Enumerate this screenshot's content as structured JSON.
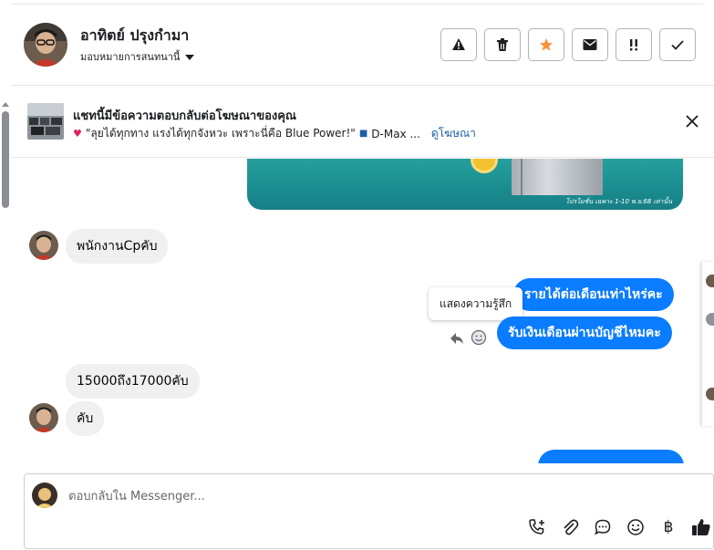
{
  "header": {
    "contact_name": "อาทิตย์ ปรุงกำมา",
    "assign_label": "มอบหมายการสนทนานี้",
    "actions": [
      {
        "name": "report-button",
        "icon": "warning-icon"
      },
      {
        "name": "delete-button",
        "icon": "trash-icon"
      },
      {
        "name": "star-button",
        "icon": "star-icon",
        "color": "#f7923b"
      },
      {
        "name": "mark-unread-button",
        "icon": "envelope-icon"
      },
      {
        "name": "priority-button",
        "icon": "double-exclamation-icon"
      },
      {
        "name": "done-button",
        "icon": "checkmark-icon"
      }
    ]
  },
  "notice": {
    "title": "แชทนี้มีข้อความตอบกลับต่อโฆษณาของคุณ",
    "ad_text": "\"ลุยได้ทุกทาง แรงได้ทุกจังหวะ เพราะนี่คือ Blue Power!\"",
    "ad_brand": "D-Max ...",
    "link_label": "ดูโฆษณา"
  },
  "chat": {
    "ad_image_caption": "โปรโมชั่น เฉพาะ 1-10 พ.ย.68 เท่านั้น",
    "incoming_1": "พนักงานCpคับ",
    "outgoing_1": "รายได้ต่อเดือนเท่าไหร่คะ",
    "outgoing_2": "รับเงินเดือนผ่านบัญชีไหมคะ",
    "tooltip": "แสดงความรู้สึก",
    "incoming_2": "15000ถึง17000คับ",
    "incoming_3": "คับ"
  },
  "composer": {
    "placeholder": "ตอบกลับใน Messenger...",
    "tools": [
      "phone-add-icon",
      "paperclip-icon",
      "saved-reply-icon",
      "emoji-icon",
      "baht-icon",
      "thumbs-up-icon"
    ],
    "baht_symbol": "฿"
  },
  "colors": {
    "accent_blue": "#0a7cff",
    "incoming_bubble": "#f0f0f0",
    "link": "#1a5fa8",
    "star": "#f7923b"
  }
}
